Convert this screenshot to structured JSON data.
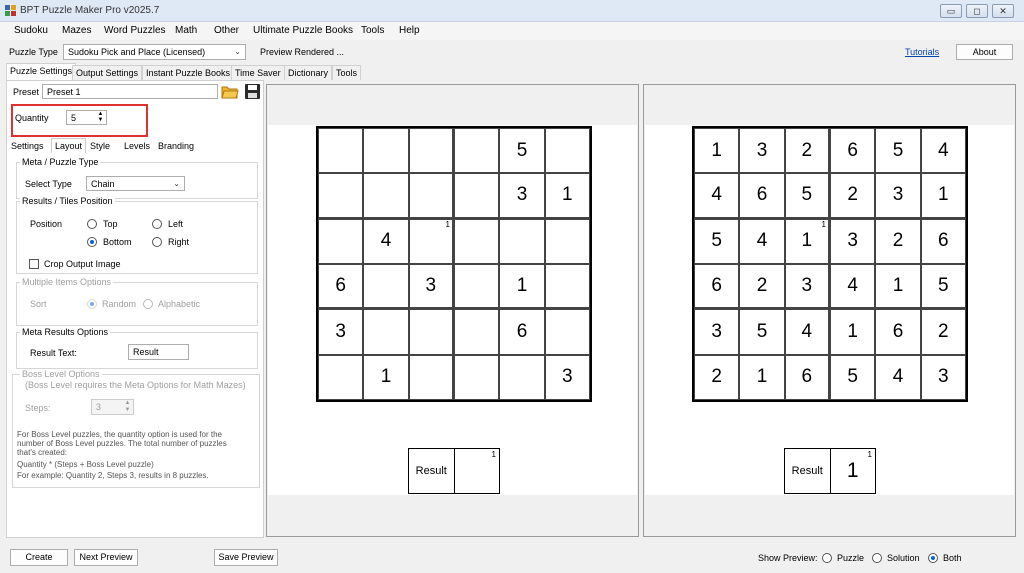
{
  "window": {
    "title": "BPT Puzzle Maker Pro v2025.7",
    "controls": [
      "▭",
      "◻",
      "✕"
    ]
  },
  "menu": [
    "Sudoku",
    "Mazes",
    "Word Puzzles",
    "Math",
    "Other",
    "Ultimate Puzzle Books",
    "Tools",
    "Help"
  ],
  "toolbar": {
    "puzzle_type_label": "Puzzle Type",
    "puzzle_type_value": "Sudoku Pick and Place (Licensed)",
    "preview_status": "Preview Rendered ...",
    "tutorials_link": "Tutorials",
    "about_button": "About"
  },
  "main_tabs": [
    "Puzzle Settings",
    "Output Settings",
    "Instant Puzzle Books",
    "Time Saver",
    "Dictionary",
    "Tools"
  ],
  "preset": {
    "label": "Preset",
    "value": "Preset 1"
  },
  "quantity": {
    "label": "Quantity",
    "value": "5"
  },
  "sub_tabs": [
    "Settings",
    "Layout",
    "Style",
    "Levels",
    "Branding"
  ],
  "meta_puzzle": {
    "group_title": "Meta / Puzzle Type",
    "select_label": "Select Type",
    "select_value": "Chain"
  },
  "results_tiles": {
    "group_title": "Results / Tiles Position",
    "position_label": "Position",
    "opt_top": "Top",
    "opt_left": "Left",
    "opt_bottom": "Bottom",
    "opt_right": "Right",
    "crop_label": "Crop Output Image"
  },
  "multiple_items": {
    "group_title": "Multiple Items Options",
    "sort_label": "Sort",
    "opt_random": "Random",
    "opt_alpha": "Alphabetic"
  },
  "meta_results": {
    "group_title": "Meta Results Options",
    "result_text_label": "Result Text:",
    "result_text_value": "Result"
  },
  "boss_level": {
    "group_title": "Boss Level Options",
    "note": "(Boss Level requires the Meta Options for Math Mazes)",
    "steps_label": "Steps:",
    "steps_value": "3",
    "help_1": "For Boss Level puzzles, the quantity option is used for the",
    "help_2": "number of Boss Level puzzles. The total number of puzzles",
    "help_3": "that's created:",
    "help_4": "Quantity * (Steps + Boss Level puzzle)",
    "help_5": "For example: Quantity 2, Steps 3, results in 8 puzzles."
  },
  "puzzle_grid": [
    [
      "",
      "",
      "",
      "",
      "5",
      ""
    ],
    [
      "",
      "",
      "",
      "",
      "3",
      "1"
    ],
    [
      "",
      "4",
      "",
      "",
      "",
      ""
    ],
    [
      "6",
      "",
      "3",
      "",
      "1",
      ""
    ],
    [
      "3",
      "",
      "",
      "",
      "6",
      ""
    ],
    [
      "",
      "1",
      "",
      "",
      "",
      "3"
    ]
  ],
  "solution_grid": [
    [
      "1",
      "3",
      "2",
      "6",
      "5",
      "4"
    ],
    [
      "4",
      "6",
      "5",
      "2",
      "3",
      "1"
    ],
    [
      "5",
      "4",
      "1",
      "3",
      "2",
      "6"
    ],
    [
      "6",
      "2",
      "3",
      "4",
      "1",
      "5"
    ],
    [
      "3",
      "5",
      "4",
      "1",
      "6",
      "2"
    ],
    [
      "2",
      "1",
      "6",
      "5",
      "4",
      "3"
    ]
  ],
  "marker": "1",
  "result_box": {
    "label": "Result",
    "puzzle_answer": "",
    "solution_answer": "1",
    "superscript": "1"
  },
  "bottom": {
    "create": "Create",
    "next_preview": "Next Preview",
    "save_preview": "Save Preview",
    "show_preview_label": "Show Preview:",
    "opt_puzzle": "Puzzle",
    "opt_solution": "Solution",
    "opt_both": "Both"
  },
  "colors": {
    "highlight": "#e03030",
    "radio_accent": "#0a64d6",
    "link": "#0645ad"
  }
}
